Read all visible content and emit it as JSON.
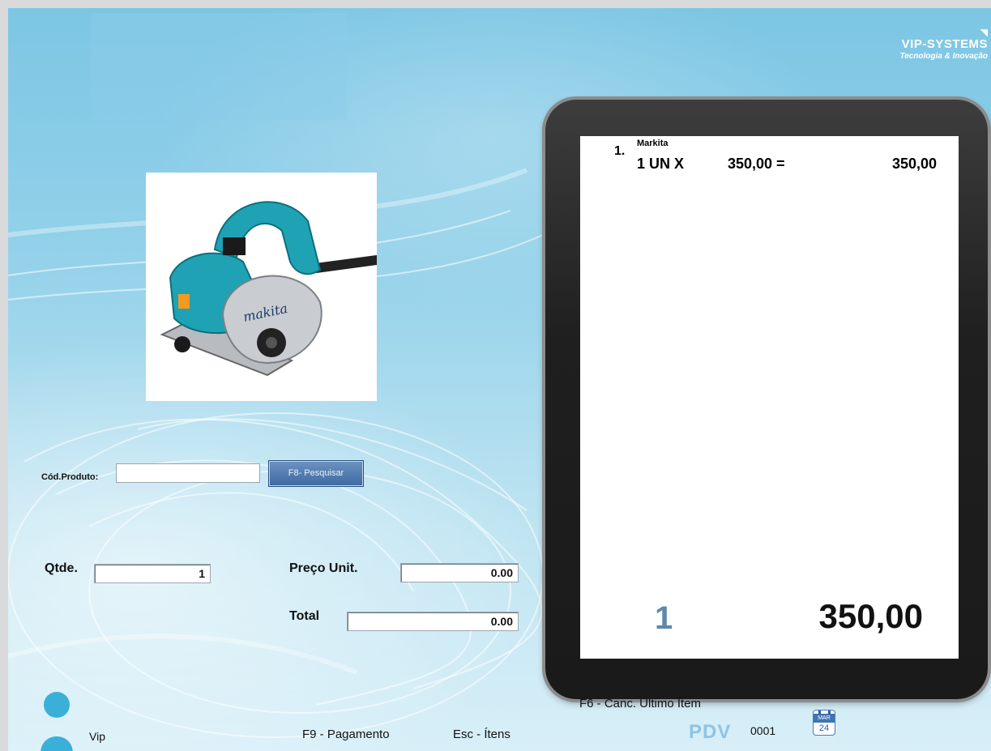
{
  "branding": {
    "logo_name": "VIP-SYSTEMS",
    "logo_tagline": "Tecnologia & Inovação"
  },
  "product": {
    "image_icon": "makita-circular-saw",
    "image_brand_text": "makita"
  },
  "form": {
    "code_label": "Cód.Produto:",
    "code_value": "",
    "search_button_label": "F8- Pesquisar",
    "qty_label": "Qtde.",
    "qty_value": "1",
    "unit_price_label": "Preço Unit.",
    "unit_price_value": "0.00",
    "total_label": "Total",
    "total_value": "0.00"
  },
  "receipt": {
    "items": [
      {
        "number": "1.",
        "name": "Markita",
        "qty_text": "1 UN X",
        "unit_price_text": "350,00 =",
        "line_total": "350,00"
      }
    ],
    "items_count": "1",
    "grand_total": "350,00"
  },
  "footer": {
    "user_name": "Vip",
    "hint_payment": "F9 - Pagamento",
    "hint_items": "Esc - Ítens",
    "hint_cancel": "F6 - Canc. Último Ítem",
    "pdv_label": "PDV",
    "pdv_number": "0001",
    "calendar_month": "MAR",
    "calendar_day": "24"
  },
  "colors": {
    "background": "#95d2ea",
    "accent_blue": "#3d6aa3",
    "count_blue": "#5e8aaa",
    "pdv_blue": "#8cc4e6"
  }
}
